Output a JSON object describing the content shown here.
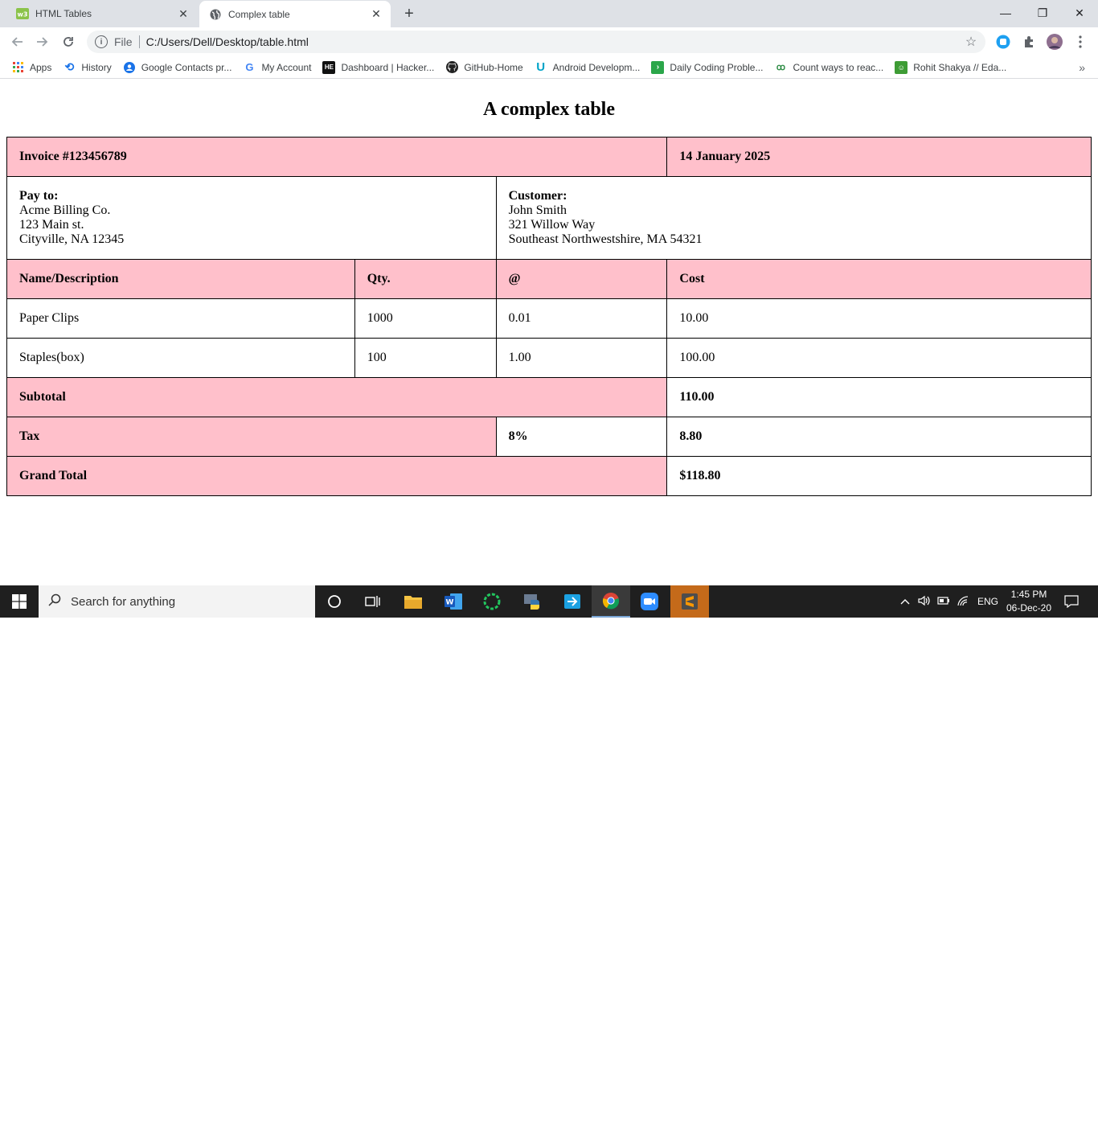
{
  "browser": {
    "tabs": [
      {
        "title": "HTML Tables",
        "icon": "w3schools-icon"
      },
      {
        "title": "Complex table",
        "icon": "globe-icon"
      }
    ],
    "new_tab": "+",
    "window_controls": {
      "minimize": "—",
      "restore": "❐",
      "close": "✕"
    },
    "address": {
      "scheme": "File",
      "url": "C:/Users/Dell/Desktop/table.html"
    },
    "bookmarks": [
      {
        "label": "Apps",
        "icon": "apps-grid-icon"
      },
      {
        "label": "History",
        "icon": "history-icon"
      },
      {
        "label": "Google Contacts pr...",
        "icon": "contacts-icon"
      },
      {
        "label": "My Account",
        "icon": "google-icon"
      },
      {
        "label": "Dashboard | Hacker...",
        "icon": "hackerearth-icon"
      },
      {
        "label": "GitHub-Home",
        "icon": "github-icon"
      },
      {
        "label": "Android Developm...",
        "icon": "udemy-icon"
      },
      {
        "label": "Daily Coding Proble...",
        "icon": "dcp-icon"
      },
      {
        "label": "Count ways to reac...",
        "icon": "gfg-icon"
      },
      {
        "label": "Rohit Shakya // Eda...",
        "icon": "edabit-icon"
      }
    ],
    "more_bookmarks": "»"
  },
  "page": {
    "heading": "A complex table",
    "invoice_label": "Invoice #123456789",
    "date": "14 January 2025",
    "pay_to": {
      "label": "Pay to:",
      "lines": [
        "Acme Billing Co.",
        "123 Main st.",
        "Cityville, NA 12345"
      ]
    },
    "customer": {
      "label": "Customer:",
      "lines": [
        "John Smith",
        "321 Willow Way",
        "Southeast Northwestshire, MA 54321"
      ]
    },
    "columns": [
      "Name/Description",
      "Qty.",
      "@",
      "Cost"
    ],
    "items": [
      {
        "name": "Paper Clips",
        "qty": "1000",
        "price": "0.01",
        "cost": "10.00"
      },
      {
        "name": "Staples(box)",
        "qty": "100",
        "price": "1.00",
        "cost": "100.00"
      }
    ],
    "subtotal": {
      "label": "Subtotal",
      "value": "110.00"
    },
    "tax": {
      "label": "Tax",
      "rate": "8%",
      "value": "8.80"
    },
    "grand_total": {
      "label": "Grand Total",
      "value": "$118.80"
    },
    "accent_color": "#ffc0cb"
  },
  "taskbar": {
    "search_placeholder": "Search for anything",
    "language": "ENG",
    "time": "1:45 PM",
    "date": "06-Dec-20"
  }
}
